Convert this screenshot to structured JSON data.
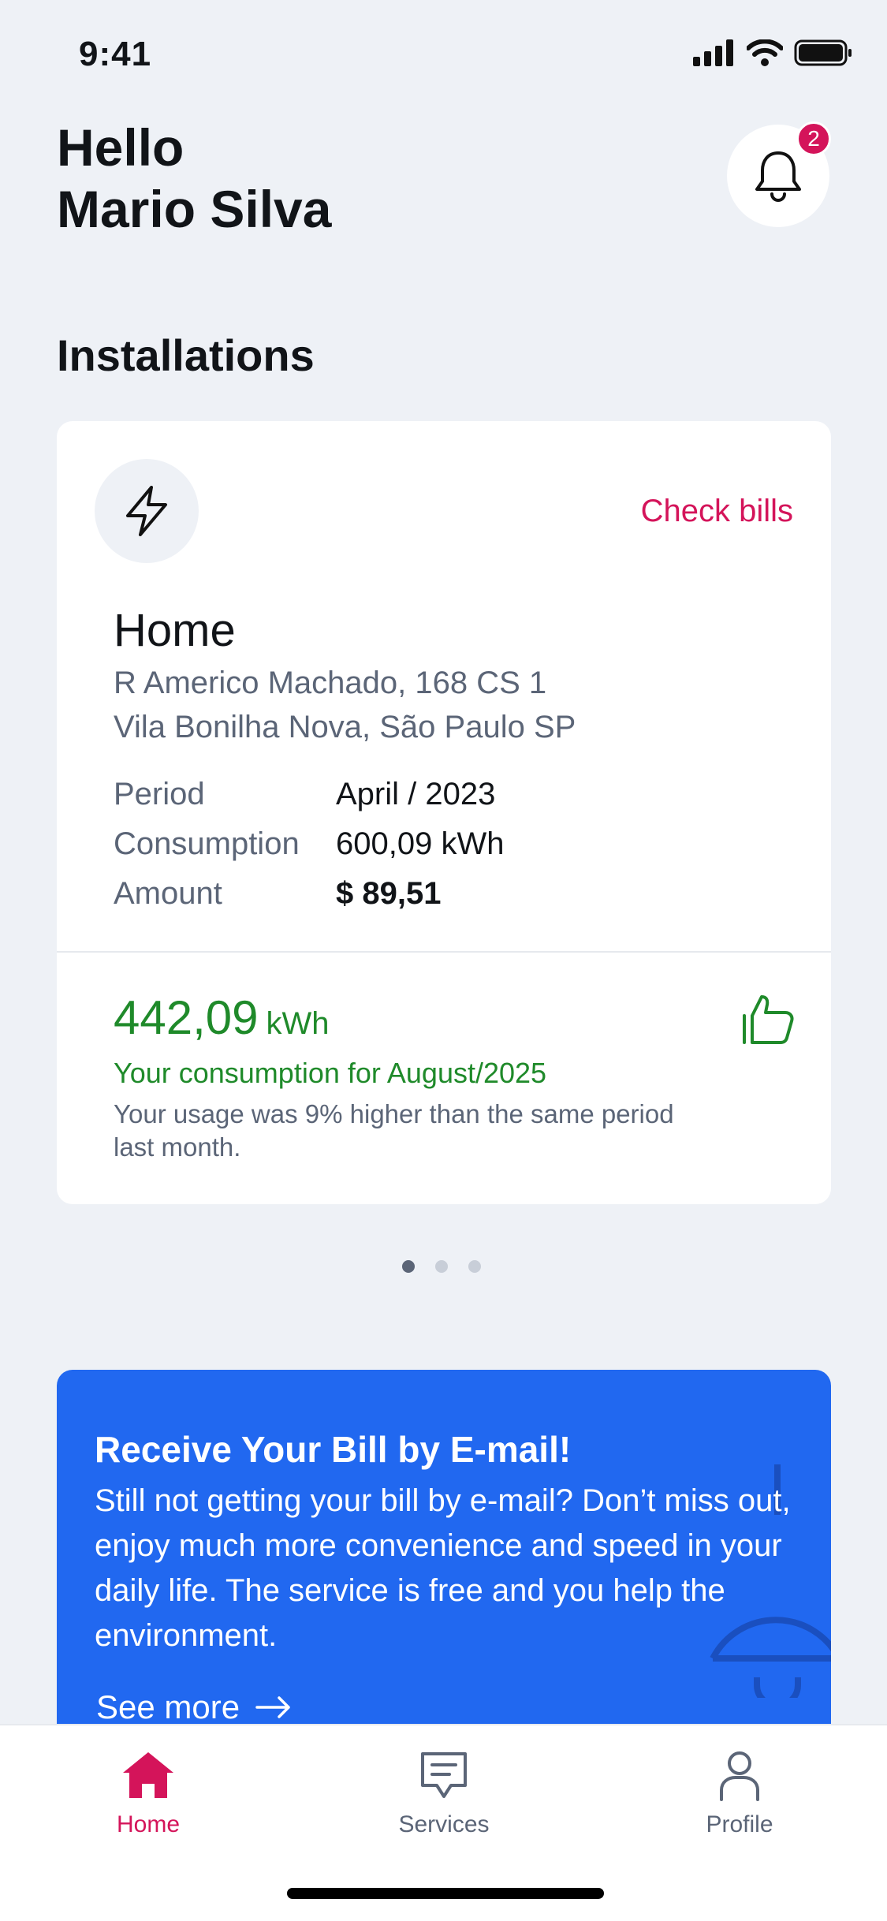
{
  "status_bar": {
    "time": "9:41"
  },
  "header": {
    "greeting_line1": "Hello",
    "greeting_line2": "Mario Silva",
    "notification_count": "2"
  },
  "installations": {
    "title": "Installations",
    "card": {
      "check_bills_label": "Check bills",
      "name": "Home",
      "address_line1": "R Americo Machado, 168 CS 1",
      "address_line2": "Vila Bonilha Nova, São Paulo SP",
      "details": [
        {
          "label": "Period",
          "value": "April / 2023"
        },
        {
          "label": "Consumption",
          "value": "600,09 kWh"
        },
        {
          "label": "Amount",
          "value": "$ 89,51"
        }
      ],
      "usage_value": "442,09",
      "usage_unit": "kWh",
      "usage_caption": "Your consumption for August/2025",
      "usage_text": "Your usage was 9% higher than the same period last month."
    },
    "pager": {
      "total": 3,
      "active_index": 0
    }
  },
  "promo": {
    "title": "Receive Your Bill by E-mail!",
    "text": "Still not getting your bill by e-mail? Don’t miss out, enjoy much more convenience and speed in your daily life. The service is free and you help the environment.",
    "link_label": "See more"
  },
  "tab_bar": {
    "tabs": [
      {
        "label": "Home",
        "icon": "home-icon",
        "active": true
      },
      {
        "label": "Services",
        "icon": "chat-icon",
        "active": false
      },
      {
        "label": "Profile",
        "icon": "user-icon",
        "active": false
      }
    ]
  },
  "colors": {
    "background": "#eef1f6",
    "accent": "#d4145a",
    "success": "#1f8a2a",
    "promo": "#2168f0",
    "muted_text": "#5b6577"
  }
}
